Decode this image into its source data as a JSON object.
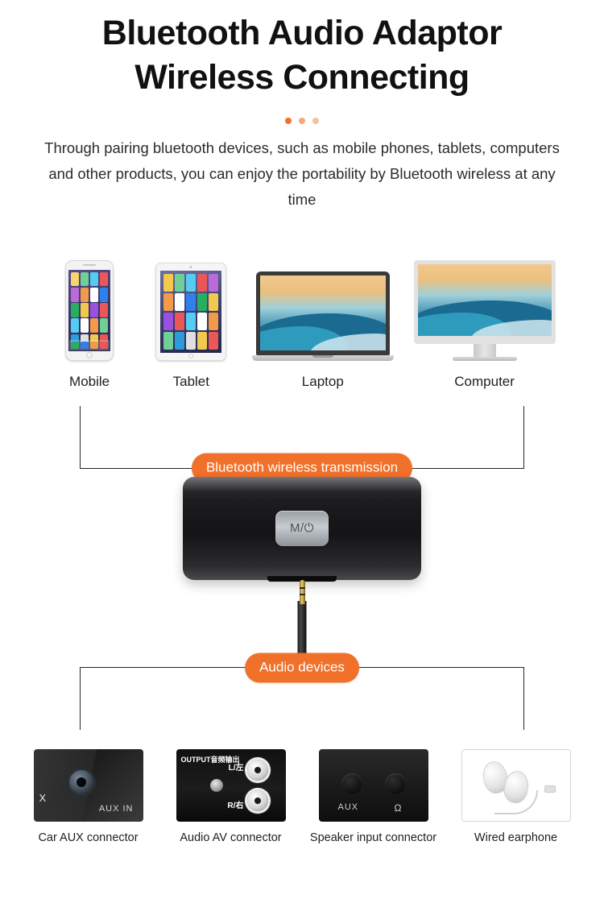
{
  "header": {
    "title_line1": "Bluetooth Audio Adaptor",
    "title_line2": "Wireless Connecting",
    "dots": [
      {
        "name": "dot-active",
        "color": "#f1702a"
      },
      {
        "name": "dot-muted",
        "color": "#f5a97a"
      },
      {
        "name": "dot-muted-2",
        "color": "#f3c0a3"
      }
    ],
    "description": "Through pairing bluetooth devices, such as mobile phones, tablets, computers and other products, you can enjoy the portability by Bluetooth wireless at any time"
  },
  "devices": [
    {
      "label": "Mobile",
      "icon": "smartphone-icon"
    },
    {
      "label": "Tablet",
      "icon": "tablet-icon"
    },
    {
      "label": "Laptop",
      "icon": "laptop-icon"
    },
    {
      "label": "Computer",
      "icon": "desktop-monitor-icon"
    }
  ],
  "badges": {
    "wireless": "Bluetooth wireless transmission",
    "audio": "Audio devices",
    "accent_color": "#f1702a"
  },
  "adaptor": {
    "button_label": "M/⏻",
    "name": "bluetooth-audio-adaptor"
  },
  "connectors": [
    {
      "label": "Car AUX connector",
      "icon": "car-aux-port-icon",
      "text_aux": "AUX IN",
      "text_x": "X"
    },
    {
      "label": "Audio AV connector",
      "icon": "rca-av-port-icon",
      "text_vertical": "OUTPUT音频输出",
      "text_l": "L/左",
      "text_r": "R/右"
    },
    {
      "label": "Speaker input connector",
      "icon": "speaker-input-port-icon",
      "text_aux": "AUX",
      "text_phone": "Ω"
    },
    {
      "label": "Wired earphone",
      "icon": "wired-earphone-icon"
    }
  ]
}
